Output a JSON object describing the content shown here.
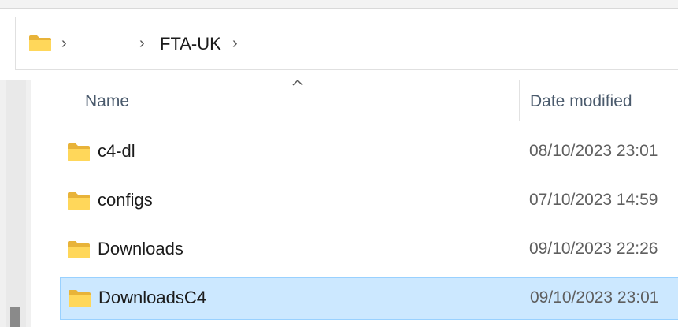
{
  "address_bar": {
    "breadcrumb": [
      "",
      "FTA-UK"
    ],
    "separator": "›"
  },
  "columns": {
    "name": "Name",
    "date_modified": "Date modified"
  },
  "files": [
    {
      "name": "c4-dl",
      "date": "08/10/2023 23:01",
      "type": "folder",
      "selected": false
    },
    {
      "name": "configs",
      "date": "07/10/2023 14:59",
      "type": "folder",
      "selected": false
    },
    {
      "name": "Downloads",
      "date": "09/10/2023 22:26",
      "type": "folder",
      "selected": false
    },
    {
      "name": "DownloadsC4",
      "date": "09/10/2023 23:01",
      "type": "folder",
      "selected": true
    }
  ],
  "colors": {
    "selection_bg": "#cce8ff",
    "selection_border": "#99d1ff",
    "folder_yellow": "#ffd75a",
    "header_text": "#4a5a6c"
  }
}
